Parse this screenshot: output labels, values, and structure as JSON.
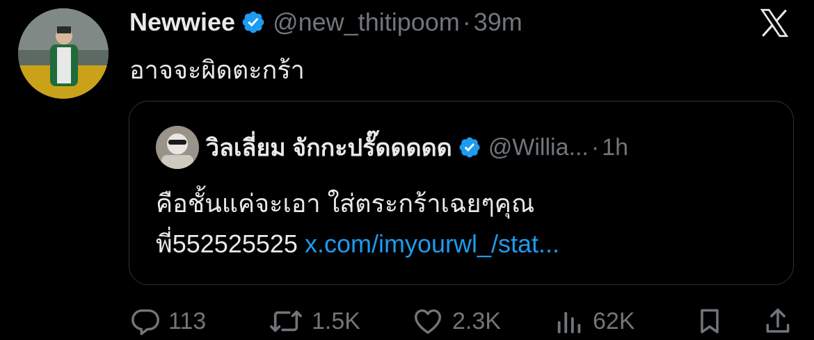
{
  "tweet": {
    "display_name": "Newwiee",
    "handle": "@new_thitipoom",
    "time": "39m",
    "text": "อาจจะผิดตะกร้า"
  },
  "quoted_tweet": {
    "display_name": "วิลเลี่ยม จักกะปรั๊ดดดดด",
    "handle": "@Willia...",
    "time": "1h",
    "text_line1": "คือชั้นแค่จะเอา ใส่ตระกร้าเฉยๆคุณ",
    "text_line2": "พี่552525525",
    "link": "x.com/imyourwl_/stat..."
  },
  "actions": {
    "replies": "113",
    "reposts": "1.5K",
    "likes": "2.3K",
    "views": "62K"
  },
  "separator": "·",
  "icons": {
    "verified": "verified-badge-icon",
    "x_logo": "x-logo-icon",
    "reply": "reply-icon",
    "repost": "repost-icon",
    "like": "like-icon",
    "views": "views-icon",
    "bookmark": "bookmark-icon",
    "share": "share-icon"
  },
  "colors": {
    "background": "#000000",
    "text": "#e7e9ea",
    "muted": "#71767b",
    "link": "#1d9bf0",
    "verified": "#1d9bf0",
    "border": "#2f3336"
  }
}
